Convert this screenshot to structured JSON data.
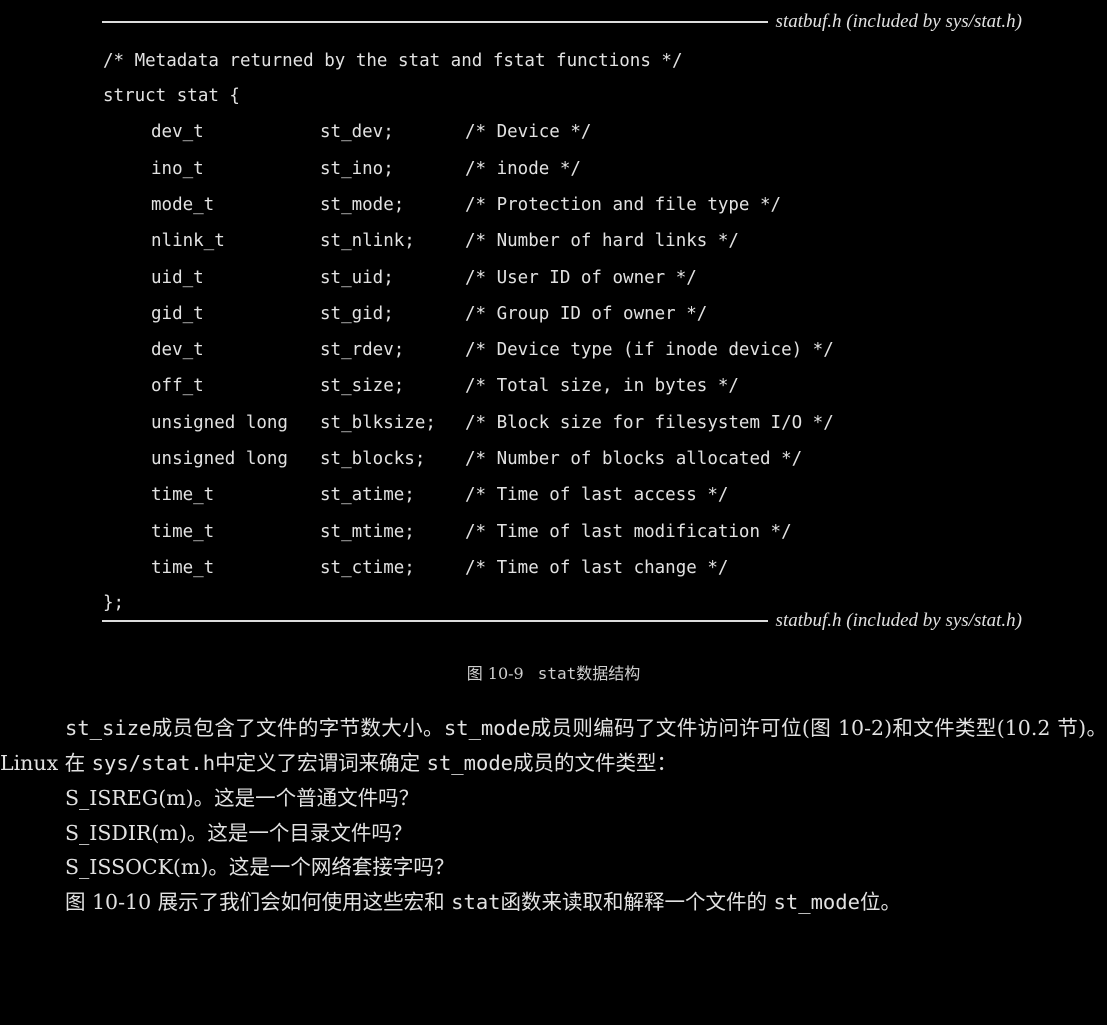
{
  "header_rule": {
    "file_label": "statbuf.h (included by sys/stat.h)"
  },
  "code": {
    "comment_line": "/* Metadata returned by the stat and fstat functions */",
    "struct_open": "struct stat {",
    "fields": [
      {
        "type": "dev_t",
        "name": "st_dev;",
        "comment": "/* Device */"
      },
      {
        "type": "ino_t",
        "name": "st_ino;",
        "comment": "/* inode */"
      },
      {
        "type": "mode_t",
        "name": "st_mode;",
        "comment": "/* Protection and file type */"
      },
      {
        "type": "nlink_t",
        "name": "st_nlink;",
        "comment": "/* Number of hard links */"
      },
      {
        "type": "uid_t",
        "name": "st_uid;",
        "comment": "/* User ID of owner */"
      },
      {
        "type": "gid_t",
        "name": "st_gid;",
        "comment": "/* Group ID of owner */"
      },
      {
        "type": "dev_t",
        "name": "st_rdev;",
        "comment": "/* Device type (if inode device) */"
      },
      {
        "type": "off_t",
        "name": "st_size;",
        "comment": "/* Total size, in bytes */"
      },
      {
        "type": "unsigned long",
        "name": "st_blksize;",
        "comment": "/* Block size for filesystem I/O */"
      },
      {
        "type": "unsigned long",
        "name": "st_blocks;",
        "comment": "/* Number of blocks allocated */"
      },
      {
        "type": "time_t",
        "name": "st_atime;",
        "comment": "/* Time of last access */"
      },
      {
        "type": "time_t",
        "name": "st_mtime;",
        "comment": "/* Time of last modification */"
      },
      {
        "type": "time_t",
        "name": "st_ctime;",
        "comment": "/* Time of last change */"
      }
    ],
    "struct_close": "};"
  },
  "footer_rule": {
    "file_label": "statbuf.h (included by sys/stat.h)"
  },
  "caption": {
    "figure_number": "图 10-9",
    "code_word": "stat",
    "title": "数据结构"
  },
  "body": {
    "para1": {
      "code1": "st_size",
      "text1": "成员包含了文件的字节数大小。",
      "code2": "st_mode",
      "text2": "成员则编码了文件访问许可位(图 10-2)和文件类型(10.2 节)。Linux 在 ",
      "code3": "sys/stat.h",
      "text3": "中定义了宏谓词来确定 ",
      "code4": "st_mode",
      "text4": "成员的文件类型："
    },
    "macros": [
      {
        "name": "S_ISREG(m)",
        "desc": "。这是一个普通文件吗？"
      },
      {
        "name": "S_ISDIR(m)",
        "desc": "。这是一个目录文件吗？"
      },
      {
        "name": "S_ISSOCK(m)",
        "desc": "。这是一个网络套接字吗？"
      }
    ],
    "para2": {
      "text1": "图 10-10 展示了我们会如何使用这些宏和 ",
      "code1": "stat",
      "text2": "函数来读取和解释一个文件的 ",
      "code2": "st_mode",
      "text3": "位。"
    }
  }
}
